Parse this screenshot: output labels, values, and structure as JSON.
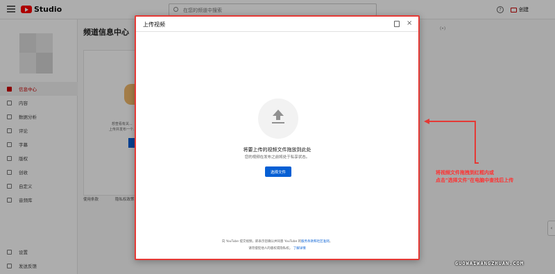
{
  "app": {
    "logo_text": "Studio",
    "search_placeholder": "在您的频道中搜索",
    "create_label": "创建"
  },
  "page": {
    "title": "频道信息中心"
  },
  "sidebar": {
    "items": [
      {
        "label": "信息中心",
        "icon": "dashboard-icon",
        "active": true
      },
      {
        "label": "内容",
        "icon": "content-icon"
      },
      {
        "label": "数据分析",
        "icon": "analytics-icon"
      },
      {
        "label": "评论",
        "icon": "comments-icon"
      },
      {
        "label": "字幕",
        "icon": "subtitles-icon"
      },
      {
        "label": "版权",
        "icon": "copyright-icon"
      },
      {
        "label": "创收",
        "icon": "earn-icon"
      },
      {
        "label": "自定义",
        "icon": "customize-icon"
      },
      {
        "label": "音频库",
        "icon": "audio-library-icon"
      }
    ],
    "bottom_items": [
      {
        "label": "设置",
        "icon": "settings-icon"
      },
      {
        "label": "发送反馈",
        "icon": "feedback-icon"
      }
    ]
  },
  "main": {
    "card_text1": "想查看有关...",
    "card_text2": "上传并发布一个...",
    "link1": "使用条款",
    "link2": "隐私权政策"
  },
  "dialog": {
    "title": "上传视频",
    "drop_main": "将要上传的视频文件拖放到此处",
    "drop_sub": "您的视频在发布之前将处于私享状态。",
    "select_button": "选择文件",
    "terms_line1_prefix": "向 YouTube 提交视频，即表示您确认并同意 YouTube 的",
    "terms_line1_link": "服务条款和社区准则",
    "terms_line2_prefix": "请勿侵犯他人的版权或隐私权。",
    "terms_line2_link": "了解详情"
  },
  "annotation": {
    "line1": "将视频文件拖拽到红框内或",
    "line2": "点击\"选择文件\"在电脑中查找后上传",
    "color": "#ff3030"
  },
  "watermark": "GUOWAIWANGZHUAN.COM"
}
